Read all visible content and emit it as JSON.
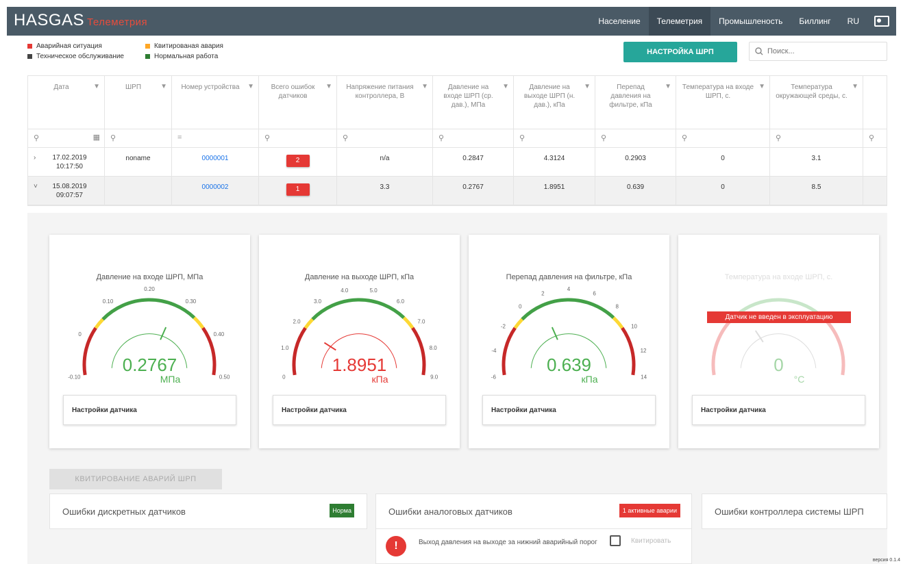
{
  "app": {
    "logo": "HASGAS",
    "logo_sub": "Телеметрия"
  },
  "nav": {
    "items": [
      "Население",
      "Телеметрия",
      "Промышленость",
      "Биллинг",
      "RU"
    ],
    "active": "Телеметрия"
  },
  "legend": [
    {
      "label": "Аварийная ситуация",
      "color": "#e53935"
    },
    {
      "label": "Квитированая авария",
      "color": "#ffa726"
    },
    {
      "label": "Техническое обслуживание",
      "color": "#444444"
    },
    {
      "label": "Нормальная работа",
      "color": "#2e7d32"
    }
  ],
  "toolbar": {
    "settings_button": "НАСТРОЙКА ШРП",
    "search_placeholder": "Поиск..."
  },
  "table": {
    "columns": [
      "Дата",
      "ШРП",
      "Номер устройства",
      "Всего ошибок датчиков",
      "Напряжение питания контроллера, В",
      "Давление на входе ШРП (ср. дав.), МПа",
      "Давление на выходе ШРП (н. дав.), кПа",
      "Перепад давления на фильтре, кПа",
      "Температура на входе ШРП, с.",
      "Температура окружающей среды, с."
    ],
    "rows": [
      {
        "expander": "›",
        "date": "17.02.2019",
        "time": "10:17:50",
        "shrp": "noname",
        "device": "0000001",
        "errors": "2",
        "voltage": "n/a",
        "p_in": "0.2847",
        "p_out": "4.3124",
        "dp": "0.2903",
        "t_in": "0",
        "t_env": "3.1"
      },
      {
        "expander": "˅",
        "date": "15.08.2019",
        "time": "09:07:57",
        "shrp": "",
        "device": "0000002",
        "errors": "1",
        "voltage": "3.3",
        "p_in": "0.2767",
        "p_out": "1.8951",
        "dp": "0.639",
        "t_in": "0",
        "t_env": "8.5"
      }
    ]
  },
  "gauges": [
    {
      "title": "Давление на входе ШРП, МПа",
      "value": "0.2767",
      "unit": "МПа",
      "color": "#4caf50",
      "ticks": [
        "-0.10",
        "0",
        "0.10",
        "0.20",
        "0.30",
        "0.40",
        "0.50"
      ],
      "settings": "Настройки датчика"
    },
    {
      "title": "Давление на выходе ШРП, кПа",
      "value": "1.8951",
      "unit": "кПа",
      "color": "#e53935",
      "ticks": [
        "0",
        "1.0",
        "2.0",
        "3.0",
        "4.0",
        "5.0",
        "6.0",
        "7.0",
        "8.0",
        "9.0"
      ],
      "settings": "Настройки датчика"
    },
    {
      "title": "Перепад давления на фильтре, кПа",
      "value": "0.639",
      "unit": "кПа",
      "color": "#4caf50",
      "ticks": [
        "-6",
        "-4",
        "-2",
        "0",
        "2",
        "4",
        "6",
        "8",
        "10",
        "12",
        "14"
      ],
      "settings": "Настройки датчика"
    },
    {
      "title": "Температура на входе ШРП, с.",
      "value": "0",
      "unit": "°C",
      "color": "#a5d6a7",
      "warning": "Датчик не введен в эксплуатацию",
      "settings": "Настройки датчика"
    }
  ],
  "ack_button": "КВИТИРОВАНИЕ АВАРИЙ ШРП",
  "errors": {
    "discrete": {
      "title": "Ошибки дискретных датчиков",
      "badge": "Норма"
    },
    "analog": {
      "title": "Ошибки аналоговых датчиков",
      "badge": "1 активные аварии"
    },
    "controller": {
      "title": "Ошибки контроллера системы ШРП"
    }
  },
  "alarm": {
    "text": "Выход давления на выходе за нижний аварийный порог",
    "ack_label": "Квитировать"
  },
  "version": "версия 0.1.4"
}
